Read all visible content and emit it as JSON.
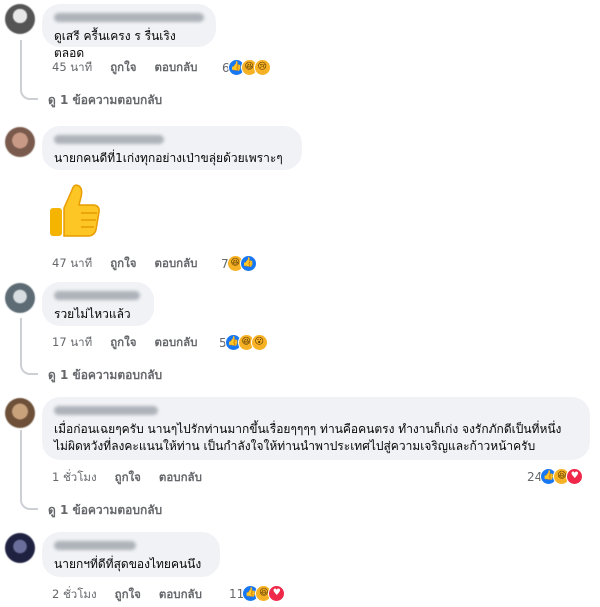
{
  "comments": [
    {
      "text": "ดูเสรี ครื้นเครง ร รื่นเริงตลอด",
      "time": "45 นาที",
      "like": "ถูกใจ",
      "reply": "ตอบกลับ",
      "react_count": "6",
      "reactions": [
        "like-icon",
        "haha-icon",
        "sad-icon"
      ],
      "replies": "ดู 1 ข้อความตอบกลับ"
    },
    {
      "text": "นายกคนดีที่1เก่งทุกอย่างเป่าขลุ่ยด้วยเพราะๆ",
      "time": "47 นาที",
      "like": "ถูกใจ",
      "reply": "ตอบกลับ",
      "react_count": "7",
      "reactions": [
        "haha-icon",
        "like-icon"
      ],
      "sticker": "thumbs-up-sticker"
    },
    {
      "text": "รวยไม่ไหวแล้ว",
      "time": "17 นาที",
      "like": "ถูกใจ",
      "reply": "ตอบกลับ",
      "react_count": "5",
      "reactions": [
        "like-icon",
        "haha-icon",
        "wow-icon"
      ],
      "replies": "ดู 1 ข้อความตอบกลับ"
    },
    {
      "text": "เมื่อก่อนเฉยๆครับ นานๆไปรักท่านมากขึ้นเรื่อยๆๆๆๆ ท่านคือคนตรง ทำงานก็เก่ง จงรักภักดีเป็นที่หนึ่ง\nไม่ผิดหวังที่ลงคะแนนให้ท่าน เป็นกำลังใจให้ท่านนำพาประเทศไปสู่ความเจริญและก้าวหน้าครับ",
      "time": "1 ชั่วโมง",
      "like": "ถูกใจ",
      "reply": "ตอบกลับ",
      "react_count": "24",
      "reactions": [
        "like-icon",
        "haha-icon",
        "love-icon"
      ],
      "replies": "ดู 1 ข้อความตอบกลับ"
    },
    {
      "text": "นายกฯที่ดีที่สุดของไทยคนนึง",
      "time": "2 ชั่วโมง",
      "like": "ถูกใจ",
      "reply": "ตอบกลับ",
      "react_count": "11",
      "reactions": [
        "like-icon",
        "haha-icon",
        "love-icon"
      ]
    }
  ],
  "colors": {
    "bubble": "#f0f2f5",
    "like_blue": "#1877f2",
    "love_red": "#f02849",
    "emoji_yellow": "#f7b125",
    "meta_gray": "#65676b"
  }
}
